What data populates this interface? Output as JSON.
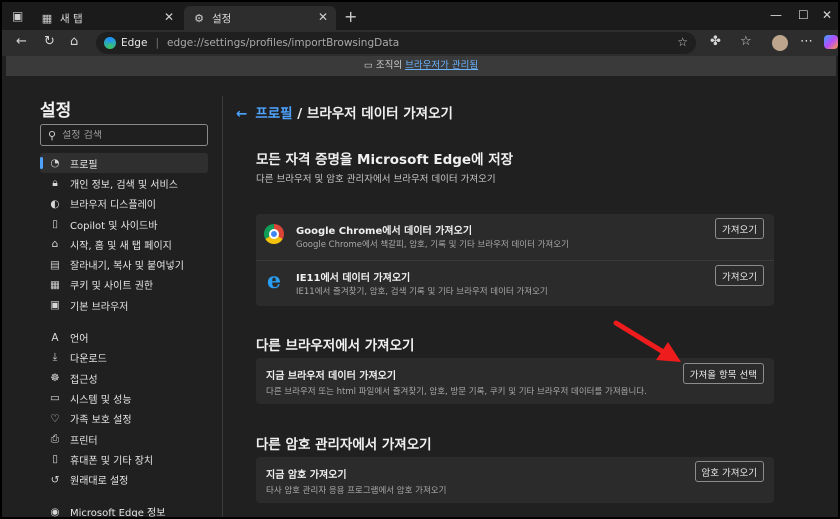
{
  "tabs": {
    "inactive_label": "새 탭",
    "active_label": "설정"
  },
  "address": {
    "site": "Edge",
    "url": "edge://settings/profiles/importBrowsingData"
  },
  "banner": {
    "prefix": "조직의",
    "link": "브라우저가 관리됨"
  },
  "sidebar": {
    "title": "설정",
    "search_placeholder": "설정 검색",
    "items": [
      {
        "label": "프로필",
        "icon": "person-icon"
      },
      {
        "label": "개인 정보, 검색 및 서비스",
        "icon": "lock-icon"
      },
      {
        "label": "브라우저 디스플레이",
        "icon": "palette-icon"
      },
      {
        "label": "Copilot 및 사이드바",
        "icon": "sidebar-icon"
      },
      {
        "label": "시작, 홈 및 새 탭 페이지",
        "icon": "home-icon"
      },
      {
        "label": "잘라내기, 복사 및 붙여넣기",
        "icon": "clipboard-icon"
      },
      {
        "label": "쿠키 및 사이트 권한",
        "icon": "cookie-icon"
      },
      {
        "label": "기본 브라우저",
        "icon": "browser-icon"
      },
      {
        "label": "언어",
        "icon": "language-icon"
      },
      {
        "label": "다운로드",
        "icon": "download-icon"
      },
      {
        "label": "접근성",
        "icon": "accessibility-icon"
      },
      {
        "label": "시스템 및 성능",
        "icon": "system-icon"
      },
      {
        "label": "가족 보호 설정",
        "icon": "family-icon"
      },
      {
        "label": "프린터",
        "icon": "printer-icon"
      },
      {
        "label": "휴대폰 및 기타 장치",
        "icon": "phone-icon"
      },
      {
        "label": "원래대로 설정",
        "icon": "reset-icon"
      },
      {
        "label": "Microsoft Edge 정보",
        "icon": "edge-icon"
      }
    ]
  },
  "main": {
    "breadcrumb_parent": "프로필",
    "breadcrumb_current": "/ 브라우저 데이터 가져오기",
    "section1": {
      "title": "모든 자격 증명을 Microsoft Edge에 저장",
      "subtitle": "다른 브라우저 및 암호 관리자에서 브라우저 데이터 가져오기",
      "rows": [
        {
          "title": "Google Chrome에서 데이터 가져오기",
          "desc": "Google Chrome에서 책갈피, 암호, 기록 및 기타 브라우저 데이터 가져오기",
          "button": "가져오기"
        },
        {
          "title": "IE11에서 데이터 가져오기",
          "desc": "IE11에서 즐겨찾기, 암호, 검색 기록 및 기타 브라우저 데이터 가져오기",
          "button": "가져오기"
        }
      ]
    },
    "section2": {
      "title": "다른 브라우저에서 가져오기",
      "row": {
        "title": "지금 브라우저 데이터 가져오기",
        "desc": "다른 브라우저 또는 html 파일에서 즐겨찾기, 암호, 방문 기록, 쿠키 및 기타 브라우저 데이터를 가져옵니다.",
        "button": "가져올 항목 선택"
      }
    },
    "section3": {
      "title": "다른 암호 관리자에서 가져오기",
      "row": {
        "title": "지금 암호 가져오기",
        "desc": "타사 암호 관리자 응용 프로그램에서 암호 가져오기",
        "button": "암호 가져오기"
      }
    }
  },
  "colors": {
    "accent": "#4ea3ff",
    "annotation_arrow": "#ee1c1c"
  }
}
